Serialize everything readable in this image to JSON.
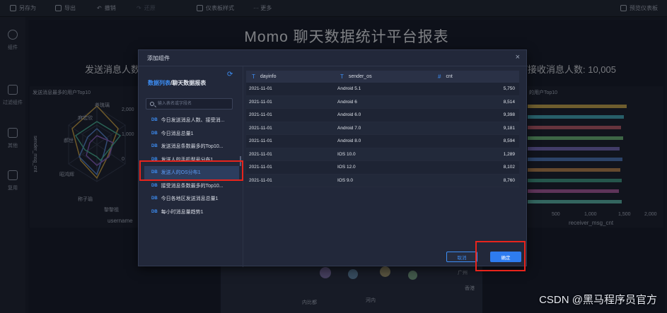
{
  "toolbar": {
    "save_as": "另存为",
    "export": "导出",
    "undo": "撤销",
    "redo": "还原",
    "dashboard_style": "仪表板样式",
    "more": "··· 更多",
    "preview": "预览仪表板"
  },
  "sidebar": {
    "items": [
      {
        "label": "组件",
        "icon": "plus-circle-icon"
      },
      {
        "label": "过滤组件",
        "icon": "filter-cube-icon"
      },
      {
        "label": "其他",
        "icon": "document-icon"
      },
      {
        "label": "复用",
        "icon": "copy-icon"
      }
    ]
  },
  "dashboard": {
    "title": "Momo 聊天数据统计平台报表",
    "kpi_left": "发送消息人数:",
    "kpi_right": "接收消息人数: 10,005",
    "left_panel_title": "发送消息最多的用户Top10",
    "right_panel_title": "的用户Top10",
    "left_axis_label": "sender_msg_cnt",
    "left_x_label": "username",
    "right_x_label": "receiver_msg_cnt",
    "radar_labels": [
      "养琉璃",
      "麻宏欣",
      "郝世",
      "昭鸿辉",
      "称子瑜",
      "黎黎祖"
    ],
    "radar_ticks": [
      "2,000",
      "1,000",
      "0"
    ],
    "right_ticks": [
      "500",
      "1,000",
      "1,500",
      "2,000"
    ],
    "map_labels": [
      "广州",
      "香港",
      "内比都",
      "河内"
    ]
  },
  "modal": {
    "title": "添加组件",
    "close": "×",
    "breadcrumb_link": "数据列表",
    "breadcrumb_sep": "/",
    "breadcrumb_current": "聊天数据报表",
    "search_placeholder": "输入表名或字段名",
    "db_tag": "DB",
    "tables": [
      "今日发送消息人数、接受消...",
      "今日消息总量1",
      "发送消息条数最多的Top10...",
      "发送人的手机型号分布1",
      "发送人的OS分布1",
      "接受消息条数最多的Top10...",
      "今日各地区发送消息总量1",
      "每小时消息量趋势1"
    ],
    "selected_index": 4,
    "columns": [
      {
        "name": "dayinfo",
        "type_icon": "T"
      },
      {
        "name": "sender_os",
        "type_icon": "T"
      },
      {
        "name": "cnt",
        "type_icon": "#"
      }
    ],
    "rows": [
      [
        "2021-11-01",
        "Android 5.1",
        "5,750"
      ],
      [
        "2021-11-01",
        "Android 6",
        "8,514"
      ],
      [
        "2021-11-01",
        "Android 6.0",
        "9,398"
      ],
      [
        "2021-11-01",
        "Android 7.0",
        "9,181"
      ],
      [
        "2021-11-01",
        "Android 8.0",
        "8,594"
      ],
      [
        "2021-11-01",
        "IOS 10.0",
        "1,289"
      ],
      [
        "2021-11-01",
        "IOS 12.0",
        "8,102"
      ],
      [
        "2021-11-01",
        "IOS 9.0",
        "8,760"
      ]
    ],
    "cancel": "取消",
    "ok": "确定"
  },
  "watermark": "CSDN @黑马程序员官方",
  "colors": {
    "accent": "#2e7cf0",
    "highlight_box": "#e8241c",
    "background": "#1e2433"
  }
}
